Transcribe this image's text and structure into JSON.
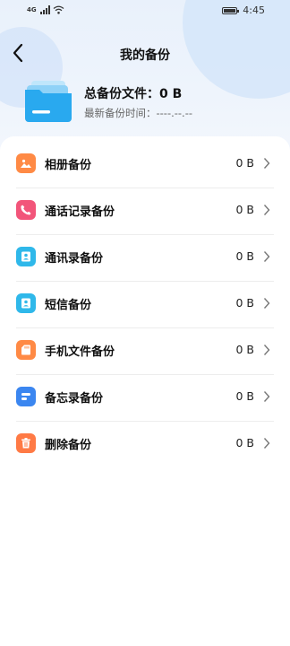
{
  "status_bar": {
    "network": "4G",
    "time": "4:45"
  },
  "header": {
    "title": "我的备份"
  },
  "summary": {
    "total_label": "总备份文件：0 B",
    "last_backup": "最新备份时间：----.--.--"
  },
  "items": [
    {
      "label": "相册备份",
      "size": "0 B",
      "icon": "photo-album-icon",
      "color": "#ff8a45"
    },
    {
      "label": "通话记录备份",
      "size": "0 B",
      "icon": "phone-icon",
      "color": "#f2557a"
    },
    {
      "label": "通讯录备份",
      "size": "0 B",
      "icon": "contacts-icon",
      "color": "#2fb8ea"
    },
    {
      "label": "短信备份",
      "size": "0 B",
      "icon": "message-icon",
      "color": "#2fb8ea"
    },
    {
      "label": "手机文件备份",
      "size": "0 B",
      "icon": "sd-card-icon",
      "color": "#ff8a45"
    },
    {
      "label": "备忘录备份",
      "size": "0 B",
      "icon": "memo-icon",
      "color": "#3b86f0"
    },
    {
      "label": "删除备份",
      "size": "0 B",
      "icon": "trash-icon",
      "color": "#ff7a45"
    }
  ]
}
